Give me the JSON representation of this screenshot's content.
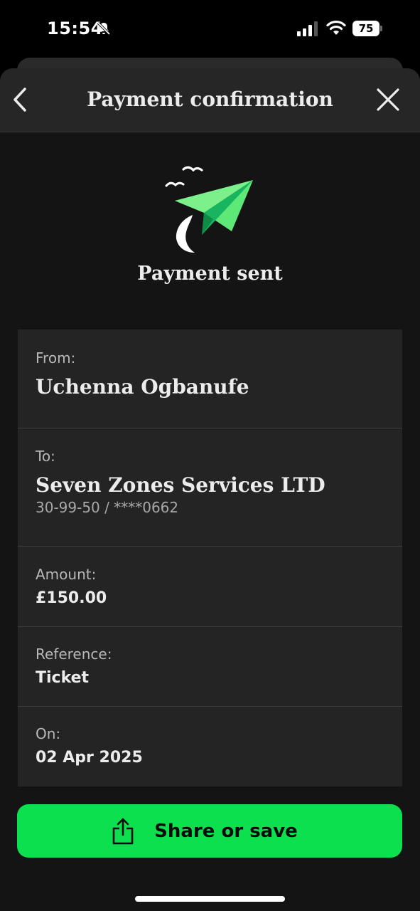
{
  "status_bar": {
    "time": "15:54",
    "battery": "75",
    "icons": [
      "bell-slash-icon",
      "signal-icon",
      "wifi-icon",
      "battery-icon"
    ]
  },
  "header": {
    "title": "Payment confirmation",
    "back_icon": "chevron-left-icon",
    "close_icon": "close-icon"
  },
  "hero": {
    "illustration": "paper-plane-illustration",
    "title": "Payment sent"
  },
  "details": {
    "from": {
      "label": "From:",
      "value": "Uchenna Ogbanufe"
    },
    "to": {
      "label": "To:",
      "value": "Seven Zones Services LTD",
      "account": "30-99-50 / ****0662"
    },
    "amount": {
      "label": "Amount:",
      "value": "£150.00"
    },
    "reference": {
      "label": "Reference:",
      "value": "Ticket"
    },
    "on": {
      "label": "On:",
      "value": "02 Apr 2025"
    }
  },
  "share_button": {
    "label": "Share or save",
    "icon": "share-icon"
  },
  "colors": {
    "accent_green": "#0de04f",
    "plane_green": "#5ee878",
    "background": "#141414",
    "card": "#242424"
  }
}
